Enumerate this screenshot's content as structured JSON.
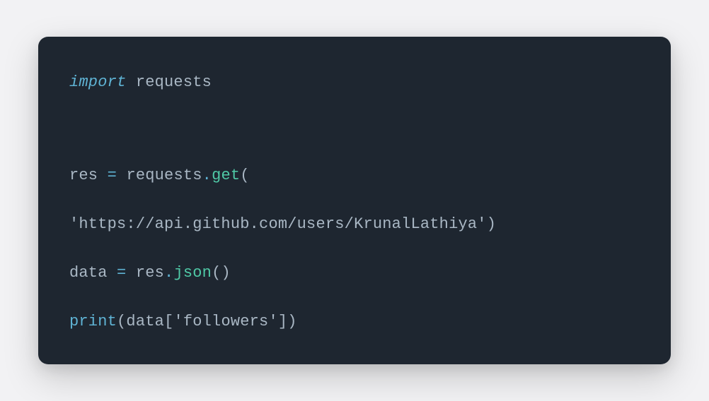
{
  "code": {
    "line1": {
      "import_kw": "import",
      "sp1": " ",
      "module": "requests"
    },
    "line2": {
      "var": "res",
      "sp1": " ",
      "eq": "=",
      "sp2": " ",
      "obj": "requests",
      "dot": ".",
      "method": "get",
      "lparen": "("
    },
    "line3": {
      "string": "'https://api.github.com/users/KrunalLathiya'",
      "rparen": ")"
    },
    "line4": {
      "var": "data",
      "sp1": " ",
      "eq": "=",
      "sp2": " ",
      "obj": "res",
      "dot": ".",
      "method": "json",
      "lparen": "(",
      "rparen": ")"
    },
    "line5": {
      "fn": "print",
      "lparen": "(",
      "arg": "data",
      "lbrack": "[",
      "key": "'followers'",
      "rbrack": "]",
      "rparen": ")"
    }
  }
}
